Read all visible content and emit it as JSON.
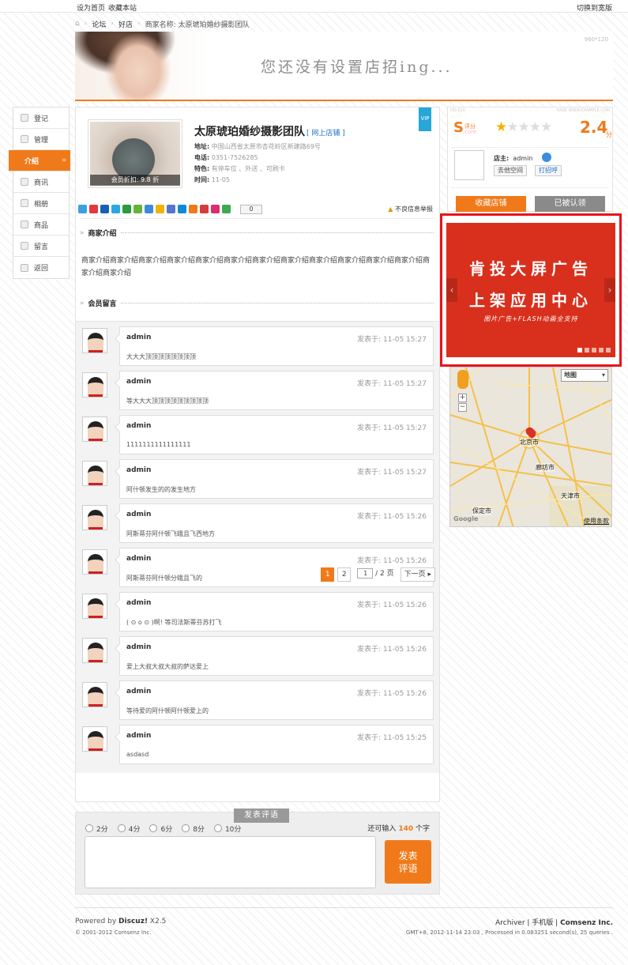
{
  "topbar": {
    "set_home": "设为首页",
    "bookmark": "收藏本站",
    "switch_style": "切换到宽版"
  },
  "breadcrumb": {
    "items": [
      "论坛",
      "好店",
      "商家名称: 太原琥珀婚纱摄影团队"
    ]
  },
  "banner": {
    "dimensions": "960*120",
    "slogan": "您还没有设置店招ing..."
  },
  "sidenav": {
    "items": [
      {
        "label": "登记"
      },
      {
        "label": "管理"
      },
      {
        "label": "介绍"
      },
      {
        "label": "商讯"
      },
      {
        "label": "相册"
      },
      {
        "label": "商品"
      },
      {
        "label": "留言"
      },
      {
        "label": "返回"
      }
    ]
  },
  "shop": {
    "name": "太原琥珀婚纱摄影团队",
    "online_link": "[ 网上店铺 ]",
    "vip": "VIP",
    "discount": "会员折扣: 9.8 折",
    "address_label": "地址:",
    "address": "中国山西省太原市杏花岭区新建路69号",
    "phone_label": "电话:",
    "phone": "0351-7526285",
    "feature_label": "特色:",
    "feature": "有停车位 、外送 、可刷卡",
    "time_label": "时间:",
    "time": "11-05",
    "share_count": "0",
    "report": "不良信息举报"
  },
  "sections": {
    "intro_title": "商家介绍",
    "intro_text": "商家介绍商家介绍商家介绍商家介绍商家介绍商家介绍商家介绍商家介绍商家介绍商家介绍商家介绍商家介绍商家介绍商家介绍",
    "comments_title": "会员留言"
  },
  "comments": [
    {
      "user": "admin",
      "time": "发表于: 11-05 15:27",
      "text": "大大大顶顶顶顶顶顶顶顶"
    },
    {
      "user": "admin",
      "time": "发表于: 11-05 15:27",
      "text": "等大大大顶顶顶顶顶顶顶顶顶"
    },
    {
      "user": "admin",
      "time": "发表于: 11-05 15:27",
      "text": "1111111111111111"
    },
    {
      "user": "admin",
      "time": "发表于: 11-05 15:27",
      "text": "阿什顿发生的的发生地方"
    },
    {
      "user": "admin",
      "time": "发表于: 11-05 15:26",
      "text": "阿斯蒂芬阿什顿飞蛾且飞西地方"
    },
    {
      "user": "admin",
      "time": "发表于: 11-05 15:26",
      "text": "阿斯蒂芬阿什顿分蛾且飞的"
    },
    {
      "user": "admin",
      "time": "发表于: 11-05 15:26",
      "text": "( ⊙ o ⊙ )啊! 等司法斯蒂芬苏打飞"
    },
    {
      "user": "admin",
      "time": "发表于: 11-05 15:26",
      "text": "爱上大叔大叔大叔的萨达爱上"
    },
    {
      "user": "admin",
      "time": "发表于: 11-05 15:26",
      "text": "等待爱的阿什顿阿什顿爱上的"
    },
    {
      "user": "admin",
      "time": "发表于: 11-05 15:25",
      "text": "asdasd"
    }
  ],
  "pager": {
    "current": "1",
    "page2": "2",
    "input": "1",
    "total": "/ 2 页",
    "next": "下一页"
  },
  "rating": {
    "tab": "发表评语",
    "options": [
      "2分",
      "4分",
      "6分",
      "8分",
      "10分"
    ],
    "remain_prefix": "还可输入",
    "remain_count": "140",
    "remain_suffix": "个字",
    "submit": "发表\n评语"
  },
  "side": {
    "tiny_left": "HD-010",
    "tiny_right": "HASE WWW.EXAMPLE.COM",
    "score_letter": "S",
    "score_label": "评分",
    "score_sub": "core",
    "score_value": "2.4",
    "score_unit": "分",
    "stars_filled": 1,
    "stars_total": 5,
    "owner_label": "店主:",
    "owner_name": "admin",
    "visit": "去他空间",
    "greet": "打招呼",
    "favorite": "收藏店铺",
    "claimed": "已被认领",
    "accent": "#f07a1a"
  },
  "ad": {
    "line1": "肯投大屏广告",
    "line2": "上架应用中心",
    "line3": "图片广告+FLASH动画全支持",
    "prev": "‹",
    "next": "›",
    "slides": 5,
    "active": 1,
    "border_color": "#e8141b"
  },
  "map": {
    "type_select": "地图",
    "cities": [
      "北京市",
      "廊坊市",
      "天津市",
      "保定市"
    ],
    "logo": "Google",
    "terms": "使用条款",
    "zoom_in": "+",
    "zoom_out": "−"
  },
  "footer": {
    "powered": "Powered by",
    "brand": "Discuz!",
    "version": "X2.5",
    "copyright": "© 2001-2012 Comsenz Inc.",
    "archiver": "Archiver",
    "mobile": "手机版",
    "company": "Comsenz Inc.",
    "gmt": "GMT+8, 2012-11-14 23:03 , Processed in 0.083251 second(s), 25 queries ."
  }
}
